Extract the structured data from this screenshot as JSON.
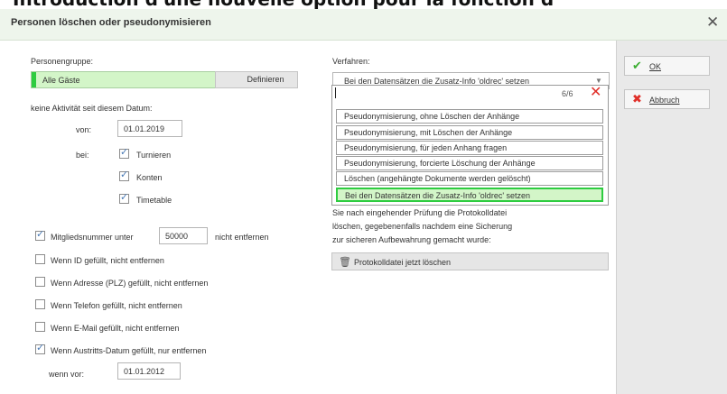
{
  "headline": "Introduction d'une nouvelle option pour la fonction d",
  "dialog": {
    "title": "Personen löschen oder pseudonymisieren"
  },
  "left": {
    "personengruppe_label": "Personengruppe:",
    "personengruppe_value": "Alle Gäste",
    "definieren_label": "Definieren",
    "inactive_label": "keine Aktivität seit diesem Datum:",
    "von_label": "von:",
    "von_value": "01.01.2019",
    "bei_label": "bei:",
    "bei_options": [
      "Turnieren",
      "Konten",
      "Timetable"
    ],
    "mitglied_label": "Mitgliedsnummer unter",
    "mitglied_value": "50000",
    "mitglied_suffix": "nicht entfernen",
    "checks": [
      "Wenn ID gefüllt, nicht entfernen",
      "Wenn Adresse (PLZ) gefüllt, nicht entfernen",
      "Wenn Telefon gefüllt, nicht entfernen",
      "Wenn E-Mail gefüllt, nicht entfernen",
      "Wenn Austritts-Datum gefüllt, nur entfernen"
    ],
    "wenn_vor_label": "wenn vor:",
    "wenn_vor_value": "01.01.2012"
  },
  "verfahren": {
    "label": "Verfahren:",
    "selected": "Bei den Datensätzen die Zusatz-Info 'oldrec' setzen",
    "count": "6/6",
    "options": [
      "Pseudonymisierung, ohne Löschen der Anhänge",
      "Pseudonymisierung, mit Löschen der Anhänge",
      "Pseudonymisierung, für jeden Anhang fragen",
      "Pseudonymisierung, forcierte Löschung der Anhänge",
      "Löschen (angehängte Dokumente werden gelöscht)",
      "Bei den Datensätzen die Zusatz-Info 'oldrec' setzen"
    ],
    "info_lines": [
      "Sie nach eingehender Prüfung die Protokolldatei",
      "löschen, gegebenenfalls nachdem eine Sicherung",
      "zur sicheren Aufbewahrung gemacht wurde:"
    ],
    "delete_log_label": "Protokolldatei jetzt löschen"
  },
  "buttons": {
    "ok": "OK",
    "cancel": "Abbruch"
  },
  "colors": {
    "accent_green": "#2ecc40",
    "selection_fill": "#d3f5c8",
    "cancel_red": "#e0302a"
  }
}
